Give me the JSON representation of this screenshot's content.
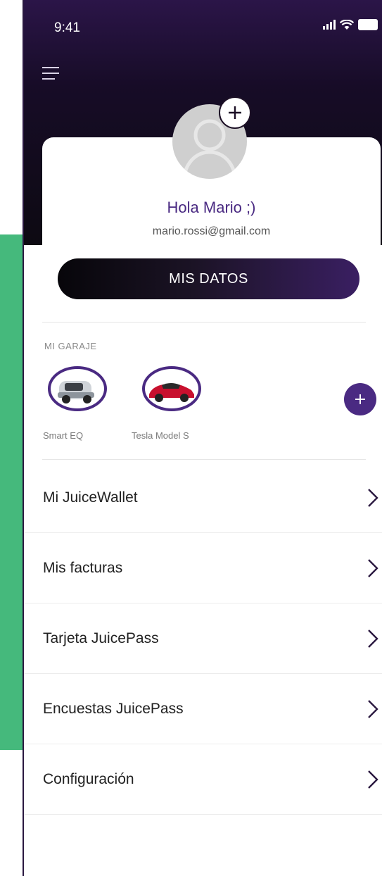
{
  "status_bar": {
    "time": "9:41",
    "icons": [
      "signal-icon",
      "wifi-icon",
      "battery-icon"
    ]
  },
  "header": {
    "menu_icon": "hamburger-menu-icon"
  },
  "profile": {
    "greeting": "Hola Mario ;)",
    "email": "mario.rossi@gmail.com",
    "avatar_icon": "user-avatar-icon",
    "add_photo_icon": "plus-icon",
    "mis_datos_label": "MIS DATOS"
  },
  "garage": {
    "title": "MI GARAJE",
    "cars": [
      {
        "name": "Smart EQ",
        "color": "#cfd3d8"
      },
      {
        "name": "Tesla Model S",
        "color": "#c8102e"
      }
    ],
    "add_icon": "plus-icon"
  },
  "menu": [
    {
      "label": "Mi JuiceWallet"
    },
    {
      "label": "Mis facturas"
    },
    {
      "label": "Tarjeta JuicePass"
    },
    {
      "label": "Encuestas JuicePass"
    },
    {
      "label": "Configuración"
    }
  ],
  "colors": {
    "accent": "#4a2a82",
    "header_dark": "#0d0a12",
    "side_band": "#45b97c"
  }
}
